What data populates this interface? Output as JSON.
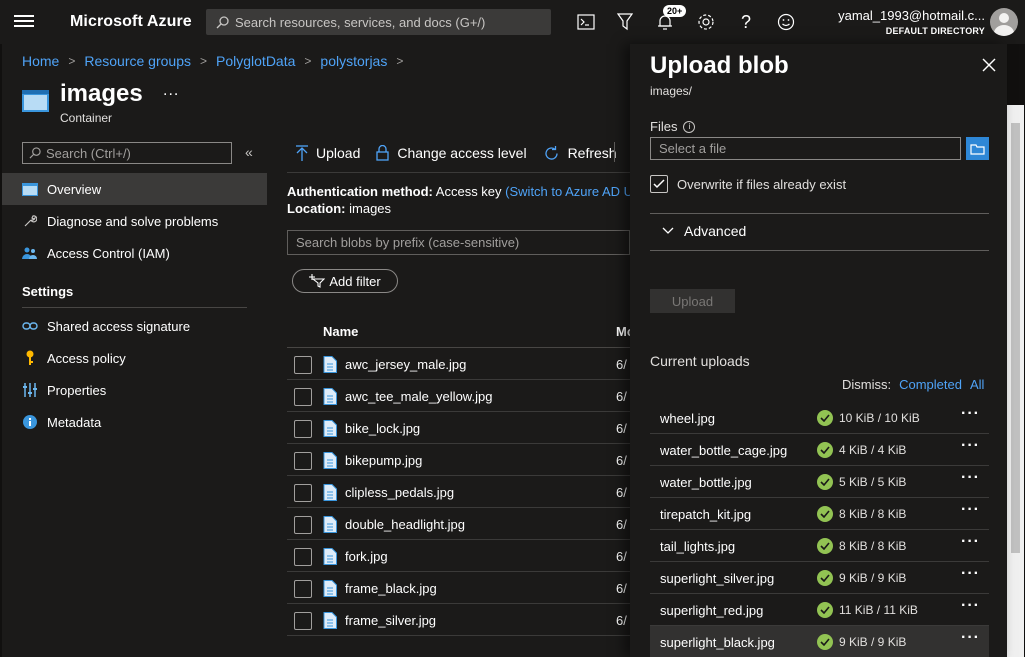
{
  "topbar": {
    "brand": "Microsoft Azure",
    "search_placeholder": "Search resources, services, and docs (G+/)",
    "notification_count": "20+",
    "account_email": "yamal_1993@hotmail.c...",
    "account_directory": "DEFAULT DIRECTORY"
  },
  "breadcrumb": [
    "Home",
    "Resource groups",
    "PolyglotData",
    "polystorjas"
  ],
  "resource": {
    "title": "images",
    "subtitle": "Container",
    "more": "..."
  },
  "sidebar": {
    "search_placeholder": "Search (Ctrl+/)",
    "collapse": "«",
    "items": [
      {
        "label": "Overview",
        "icon": "container-icon"
      },
      {
        "label": "Diagnose and solve problems",
        "icon": "wrench-icon"
      },
      {
        "label": "Access Control (IAM)",
        "icon": "people-icon"
      }
    ],
    "section_settings": "Settings",
    "settings_items": [
      {
        "label": "Shared access signature",
        "icon": "link-icon"
      },
      {
        "label": "Access policy",
        "icon": "key-icon"
      },
      {
        "label": "Properties",
        "icon": "sliders-icon"
      },
      {
        "label": "Metadata",
        "icon": "info-icon"
      }
    ]
  },
  "commands": {
    "upload": "Upload",
    "change_access": "Change access level",
    "refresh": "Refresh"
  },
  "auth": {
    "method_label": "Authentication method:",
    "method_value": "Access key",
    "switch_link": "(Switch to Azure AD U",
    "location_label": "Location:",
    "location_value": "images"
  },
  "blob_search_placeholder": "Search blobs by prefix (case-sensitive)",
  "add_filter": "Add filter",
  "table": {
    "col_name": "Name",
    "col_modified": "Mo",
    "rows": [
      {
        "name": "awc_jersey_male.jpg",
        "date": "6/"
      },
      {
        "name": "awc_tee_male_yellow.jpg",
        "date": "6/"
      },
      {
        "name": "bike_lock.jpg",
        "date": "6/"
      },
      {
        "name": "bikepump.jpg",
        "date": "6/"
      },
      {
        "name": "clipless_pedals.jpg",
        "date": "6/"
      },
      {
        "name": "double_headlight.jpg",
        "date": "6/"
      },
      {
        "name": "fork.jpg",
        "date": "6/"
      },
      {
        "name": "frame_black.jpg",
        "date": "6/"
      },
      {
        "name": "frame_silver.jpg",
        "date": "6/"
      }
    ]
  },
  "panel": {
    "title": "Upload blob",
    "subtitle": "images/",
    "files_label": "Files",
    "file_placeholder": "Select a file",
    "overwrite_label": "Overwrite if files already exist",
    "advanced": "Advanced",
    "upload_button": "Upload",
    "current_uploads": "Current uploads",
    "dismiss_label": "Dismiss:",
    "dismiss_completed": "Completed",
    "dismiss_all": "All",
    "uploads": [
      {
        "name": "wheel.jpg",
        "size": "10 KiB / 10 KiB"
      },
      {
        "name": "water_bottle_cage.jpg",
        "size": "4 KiB / 4 KiB"
      },
      {
        "name": "water_bottle.jpg",
        "size": "5 KiB / 5 KiB"
      },
      {
        "name": "tirepatch_kit.jpg",
        "size": "8 KiB / 8 KiB"
      },
      {
        "name": "tail_lights.jpg",
        "size": "8 KiB / 8 KiB"
      },
      {
        "name": "superlight_silver.jpg",
        "size": "9 KiB / 9 KiB"
      },
      {
        "name": "superlight_red.jpg",
        "size": "11 KiB / 11 KiB"
      },
      {
        "name": "superlight_black.jpg",
        "size": "9 KiB / 9 KiB"
      }
    ]
  },
  "colors": {
    "accent": "#4fa3f7",
    "success": "#92c353",
    "topbar": "#1b1a19",
    "browse": "#2e87d6"
  }
}
